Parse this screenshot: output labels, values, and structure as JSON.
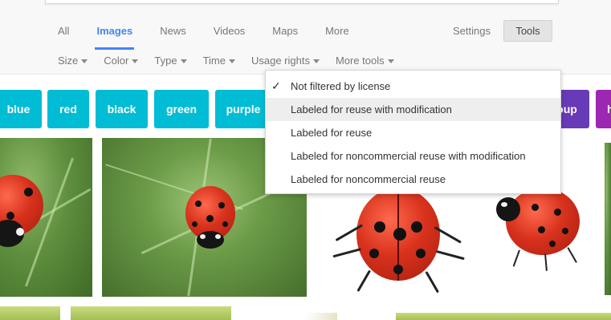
{
  "nav": {
    "tabs": [
      {
        "label": "All"
      },
      {
        "label": "Images"
      },
      {
        "label": "News"
      },
      {
        "label": "Videos"
      },
      {
        "label": "Maps"
      },
      {
        "label": "More"
      }
    ],
    "settings_label": "Settings",
    "tools_label": "Tools"
  },
  "filters": [
    {
      "label": "Size"
    },
    {
      "label": "Color"
    },
    {
      "label": "Type"
    },
    {
      "label": "Time"
    },
    {
      "label": "Usage rights"
    },
    {
      "label": "More tools"
    }
  ],
  "chips": [
    {
      "label": "blue",
      "color": "#00bcd4"
    },
    {
      "label": "red",
      "color": "#00bcd4"
    },
    {
      "label": "black",
      "color": "#00bcd4"
    },
    {
      "label": "green",
      "color": "#00bcd4"
    },
    {
      "label": "purple",
      "color": "#00bcd4"
    },
    {
      "label": "oup",
      "color": "#673ab7"
    },
    {
      "label": "h",
      "color": "#9c27b0"
    }
  ],
  "usage_rights_menu": {
    "items": [
      {
        "label": "Not filtered by license",
        "checked": true
      },
      {
        "label": "Labeled for reuse with modification",
        "hover": true
      },
      {
        "label": "Labeled for reuse"
      },
      {
        "label": "Labeled for noncommercial reuse with modification"
      },
      {
        "label": "Labeled for noncommercial reuse"
      }
    ],
    "check_glyph": "✓"
  },
  "colors": {
    "accent": "#4285f4",
    "chip": "#00bcd4"
  }
}
